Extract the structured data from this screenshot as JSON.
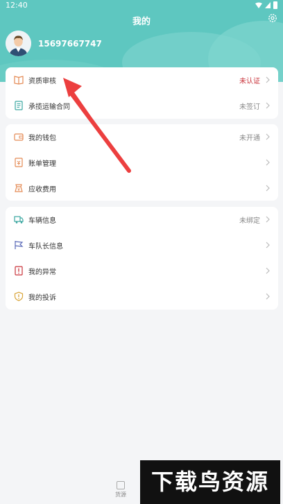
{
  "status_bar": {
    "time": "12:40"
  },
  "header": {
    "title": "我的",
    "phone": "15697667747"
  },
  "sections": [
    {
      "items": [
        {
          "label": "资质审核",
          "status": "未认证",
          "icon": "book-icon"
        },
        {
          "label": "承揽运输合同",
          "status": "未签订",
          "icon": "contract-icon"
        }
      ]
    },
    {
      "items": [
        {
          "label": "我的钱包",
          "status": "未开通",
          "icon": "wallet-icon"
        },
        {
          "label": "账单管理",
          "status": "",
          "icon": "bill-icon"
        },
        {
          "label": "应收费用",
          "status": "",
          "icon": "receivable-icon"
        }
      ]
    },
    {
      "items": [
        {
          "label": "车辆信息",
          "status": "未绑定",
          "icon": "truck-icon"
        },
        {
          "label": "车队长信息",
          "status": "",
          "icon": "flag-icon"
        },
        {
          "label": "我的异常",
          "status": "",
          "icon": "exception-icon"
        },
        {
          "label": "我的投诉",
          "status": "",
          "icon": "complaint-icon"
        }
      ]
    }
  ],
  "bottom_tabs": [
    {
      "label": "货源"
    }
  ],
  "watermark": {
    "text": "下载鸟资源"
  },
  "colors": {
    "header": "#5ec7c0",
    "icon": "#e48a54",
    "alert": "#c9333a",
    "arrow": "#ec3f3f"
  }
}
